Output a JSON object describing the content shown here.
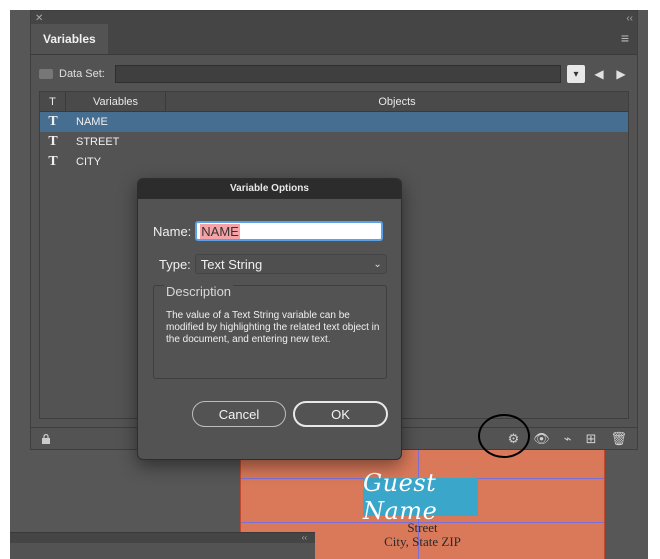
{
  "panel": {
    "tab_label": "Variables",
    "dataset_label": "Data Set:",
    "columns": {
      "type": "T",
      "variables": "Variables",
      "objects": "Objects"
    },
    "rows": [
      {
        "type": "T",
        "name": "NAME",
        "selected": true
      },
      {
        "type": "T",
        "name": "STREET",
        "selected": false
      },
      {
        "type": "T",
        "name": "CITY",
        "selected": false
      }
    ]
  },
  "dialog": {
    "title": "Variable Options",
    "name_label": "Name:",
    "name_value": "NAME",
    "type_label": "Type:",
    "type_value": "Text String",
    "description_label": "Description",
    "description_text": "The value of a Text String variable can be modified by highlighting the related text object in the document, and entering new text.",
    "cancel_label": "Cancel",
    "ok_label": "OK"
  },
  "artboard": {
    "guest_name": "Guest Name",
    "street": "Street",
    "city_state": "City, State ZIP"
  },
  "colors": {
    "selected_row": "#456e91",
    "artboard": "#d9795a",
    "guest_name_bg": "#3aa6c9"
  }
}
